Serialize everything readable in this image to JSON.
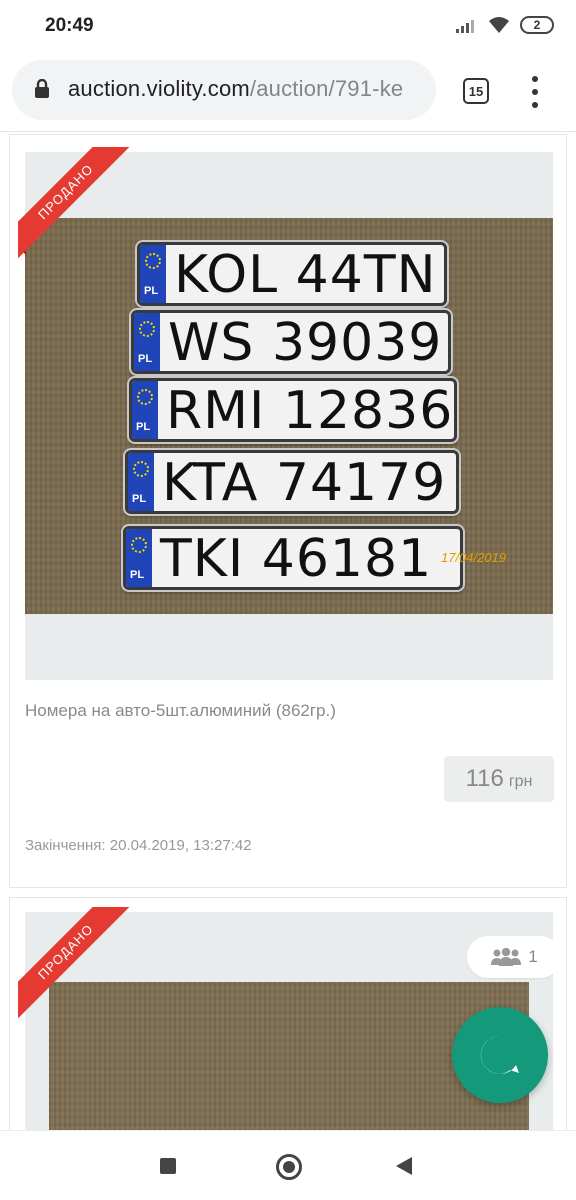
{
  "status_bar": {
    "time": "20:49",
    "battery": "2"
  },
  "browser": {
    "url_domain": "auction.violity.com",
    "url_path": "/auction/791-kе",
    "tab_count": "15"
  },
  "icons": {
    "lock": "lock-icon",
    "menu": "more-vert-icon",
    "signal": "signal-icon",
    "wifi": "wifi-icon",
    "battery": "battery-icon",
    "chat": "chat-icon",
    "users": "users-icon"
  },
  "colors": {
    "ribbon": "#e53a32",
    "fab": "#15997b"
  },
  "lots": [
    {
      "badge": "ПРОДАНО",
      "plates": [
        "KOL 44TN",
        "WS 39039",
        "RMI 12836",
        "KTA 74179",
        "TKI 46181"
      ],
      "plate_country": "PL",
      "photo_date": "17/04/2019",
      "title": "Номера на авто-5шт.алюминий (862гр.)",
      "price": "116",
      "currency": "грн",
      "end_text": "Закінчення: 20.04.2019, 13:27:42"
    },
    {
      "badge": "ПРОДАНО",
      "bidders": "1"
    }
  ]
}
